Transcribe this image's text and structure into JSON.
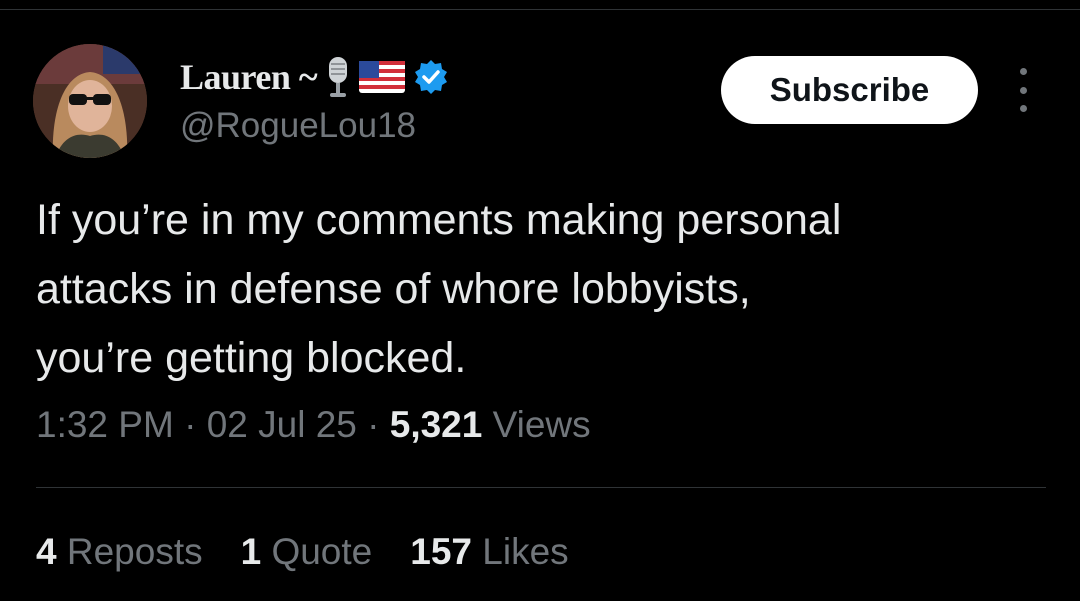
{
  "author": {
    "display_name": "Lauren ~",
    "handle": "@RogueLou18",
    "verified": true,
    "verified_color": "#1d9bf0",
    "name_icons": [
      "microphone-emoji",
      "us-flag-emoji",
      "verified-badge"
    ]
  },
  "actions": {
    "subscribe_label": "Subscribe",
    "more_icon": "more-vertical-icon"
  },
  "tweet": {
    "text": "If you’re in my comments making personal\nattacks in defense of whore lobbyists,\nyou’re getting blocked.",
    "time": "1:32 PM",
    "date": "02 Jul 25",
    "views_count": "5,321",
    "views_label": "Views",
    "separator": "·"
  },
  "stats": {
    "reposts_count": "4",
    "reposts_label": "Reposts",
    "quote_count": "1",
    "quote_label": "Quote",
    "likes_count": "157",
    "likes_label": "Likes"
  },
  "colors": {
    "background": "#000000",
    "primary_text": "#e7e9ea",
    "secondary_text": "#71767b",
    "divider": "#2f3336",
    "button_bg": "#ffffff"
  }
}
